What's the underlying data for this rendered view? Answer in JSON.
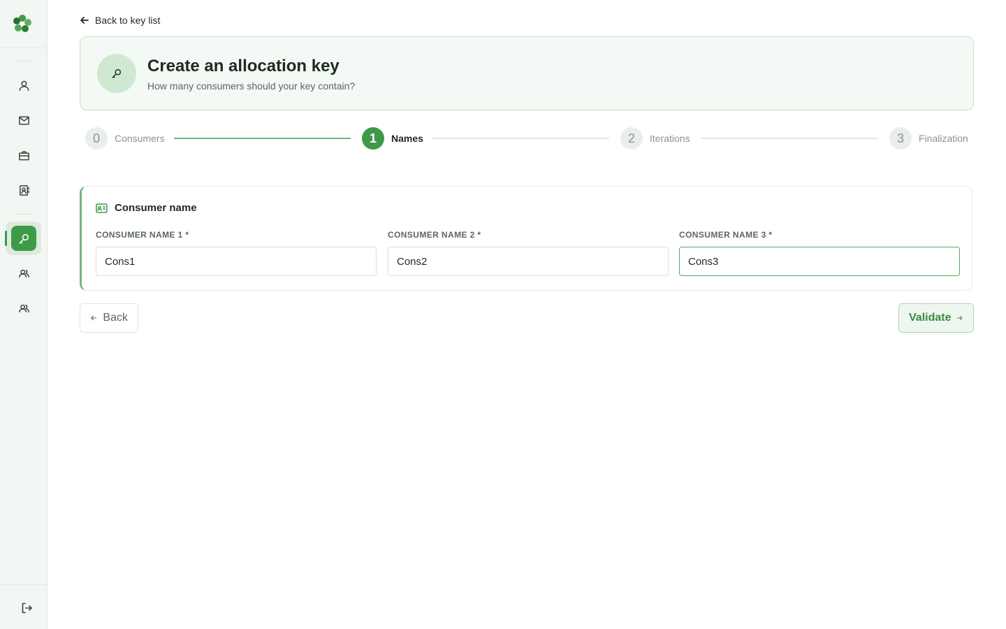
{
  "nav": {
    "back_to_list": "Back to key list"
  },
  "header": {
    "title": "Create an allocation key",
    "subtitle": "How many consumers should your key contain?",
    "icon": "key-icon"
  },
  "stepper": {
    "current_index": 1,
    "steps": [
      {
        "number": "0",
        "label": "Consumers",
        "state": "done"
      },
      {
        "number": "1",
        "label": "Names",
        "state": "current"
      },
      {
        "number": "2",
        "label": "Iterations",
        "state": "upcoming"
      },
      {
        "number": "3",
        "label": "Finalization",
        "state": "upcoming"
      }
    ]
  },
  "form": {
    "title": "Consumer name",
    "fields": [
      {
        "label": "CONSUMER NAME 1 *",
        "value": "Cons1"
      },
      {
        "label": "CONSUMER NAME 2 *",
        "value": "Cons2"
      },
      {
        "label": "CONSUMER NAME 3 *",
        "value": "Cons3"
      }
    ]
  },
  "actions": {
    "back_label": "Back",
    "validate_label": "Validate"
  },
  "sidebar": {
    "items": [
      {
        "name": "user-icon"
      },
      {
        "name": "mail-icon"
      },
      {
        "name": "briefcase-icon"
      },
      {
        "name": "contact-book-icon"
      },
      {
        "name": "key-icon",
        "active": true
      },
      {
        "name": "users-icon"
      },
      {
        "name": "users-alt-icon"
      }
    ],
    "logout_icon": "logout-icon"
  },
  "colors": {
    "accent": "#3f9a48",
    "accent_light": "#cfe8d2",
    "header_bg": "#f3f9f4",
    "sidebar_bg": "#f3f7f4"
  }
}
